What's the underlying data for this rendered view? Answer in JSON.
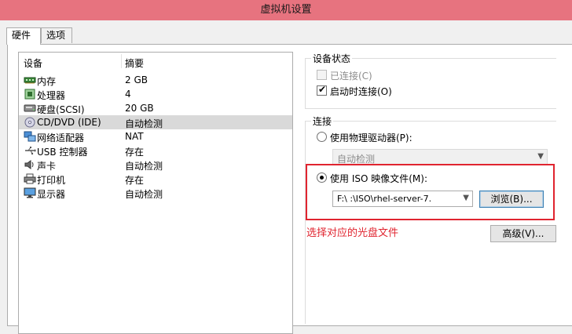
{
  "window": {
    "title": "虚拟机设置"
  },
  "tabs": [
    {
      "label": "硬件",
      "active": true
    },
    {
      "label": "选项",
      "active": false
    }
  ],
  "device_list": {
    "headers": {
      "device": "设备",
      "summary": "摘要"
    },
    "rows": [
      {
        "icon": "memory-icon",
        "name": "内存",
        "summary": "2 GB",
        "selected": false
      },
      {
        "icon": "processor-icon",
        "name": "处理器",
        "summary": "4",
        "selected": false
      },
      {
        "icon": "hard-disk-icon",
        "name": "硬盘(SCSI)",
        "summary": "20 GB",
        "selected": false
      },
      {
        "icon": "cd-dvd-icon",
        "name": "CD/DVD (IDE)",
        "summary": "自动检测",
        "selected": true
      },
      {
        "icon": "network-adapter-icon",
        "name": "网络适配器",
        "summary": "NAT",
        "selected": false
      },
      {
        "icon": "usb-icon",
        "name": "USB 控制器",
        "summary": "存在",
        "selected": false
      },
      {
        "icon": "sound-card-icon",
        "name": "声卡",
        "summary": "自动检测",
        "selected": false
      },
      {
        "icon": "printer-icon",
        "name": "打印机",
        "summary": "存在",
        "selected": false
      },
      {
        "icon": "display-icon",
        "name": "显示器",
        "summary": "自动检测",
        "selected": false
      }
    ]
  },
  "device_status": {
    "title": "设备状态",
    "connected": {
      "label": "已连接(C)",
      "checked": false,
      "enabled": false
    },
    "connect_at_power_on": {
      "label": "启动时连接(O)",
      "checked": true,
      "enabled": true
    }
  },
  "connection": {
    "title": "连接",
    "use_physical_drive": {
      "label": "使用物理驱动器(P):",
      "selected": false
    },
    "physical_drive_select": {
      "value": "自动检测",
      "enabled": false
    },
    "use_iso": {
      "label": "使用 ISO 映像文件(M):",
      "selected": true
    },
    "iso_path": {
      "value": "F:\\           :\\ISO\\rhel-server-7."
    },
    "browse_button": "浏览(B)...",
    "advanced_button": "高级(V)..."
  },
  "annotation": "选择对应的光盘文件",
  "colors": {
    "titlebar": "#e7737f",
    "annotation": "#e0242f",
    "selected_row": "#d9d9d9"
  }
}
